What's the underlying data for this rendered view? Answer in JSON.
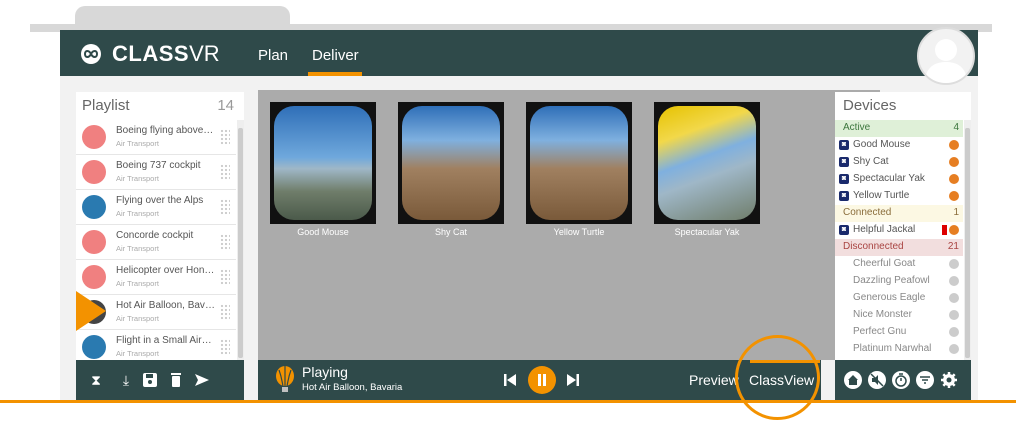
{
  "app": {
    "brand_bold": "CLASS",
    "brand_light": "VR"
  },
  "nav": {
    "items": [
      "Plan",
      "Deliver"
    ],
    "active": "Deliver"
  },
  "playlist": {
    "title": "Playlist",
    "count": "14",
    "items": [
      {
        "title": "Boeing flying above th...",
        "subtitle": "Air Transport",
        "icon_color": "#f08080"
      },
      {
        "title": "Boeing 737 cockpit",
        "subtitle": "Air Transport",
        "icon_color": "#f08080"
      },
      {
        "title": "Flying over the Alps",
        "subtitle": "Air Transport",
        "icon_color": "#2a7ab0"
      },
      {
        "title": "Concorde cockpit",
        "subtitle": "Air Transport",
        "icon_color": "#f08080"
      },
      {
        "title": "Helicopter over Hong ...",
        "subtitle": "Air Transport",
        "icon_color": "#f08080"
      },
      {
        "title": "Hot Air Balloon, Bavaria",
        "subtitle": "Air Transport",
        "icon_color": "#444"
      },
      {
        "title": "Flight in a Small Aircraft",
        "subtitle": "Air Transport",
        "icon_color": "#2a7ab0"
      }
    ]
  },
  "views": [
    {
      "label": "Good Mouse"
    },
    {
      "label": "Shy Cat"
    },
    {
      "label": "Yellow Turtle"
    },
    {
      "label": "Spectacular Yak"
    }
  ],
  "devices": {
    "title": "Devices",
    "groups": {
      "active": {
        "label": "Active",
        "count": "4",
        "items": [
          "Good Mouse",
          "Shy Cat",
          "Spectacular Yak",
          "Yellow Turtle"
        ]
      },
      "connected": {
        "label": "Connected",
        "count": "1",
        "items": [
          "Helpful Jackal"
        ]
      },
      "disconnected": {
        "label": "Disconnected",
        "count": "21",
        "items": [
          "Cheerful Goat",
          "Dazzling Peafowl",
          "Generous Eagle",
          "Nice Monster",
          "Perfect Gnu",
          "Platinum Narwhal"
        ]
      }
    }
  },
  "player": {
    "status": "Playing",
    "current": "Hot Air Balloon, Bavaria",
    "preview_label": "Preview",
    "classview_label": "ClassView"
  },
  "colors": {
    "accent": "#f39200",
    "header": "#2f4a4a"
  }
}
